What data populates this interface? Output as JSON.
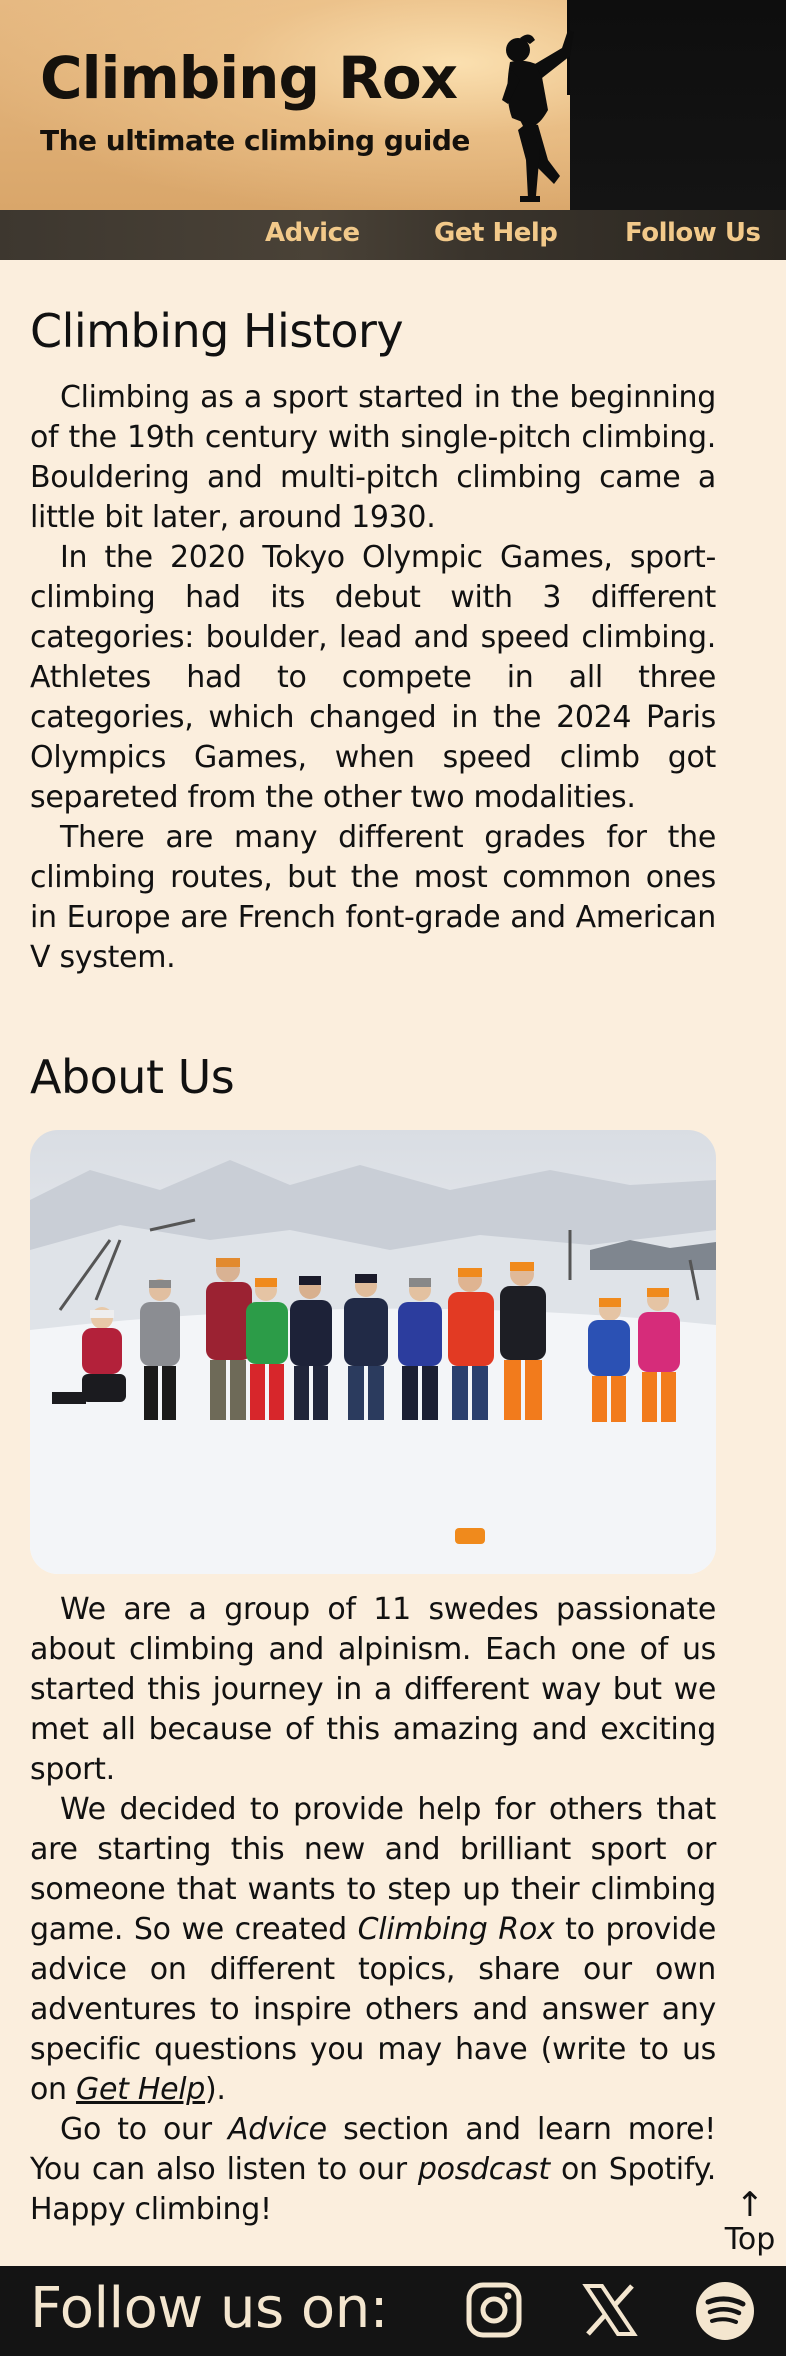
{
  "header": {
    "title": "Climbing Rox",
    "subtitle": "The ultimate climbing guide"
  },
  "nav": {
    "items": [
      {
        "label": "Advice"
      },
      {
        "label": "Get Help"
      },
      {
        "label": "Follow Us"
      }
    ]
  },
  "history": {
    "title": "Climbing History",
    "paragraphs": [
      "Climbing as a sport started in the beginning of the 19th century with single-pitch climbing. Bouldering and multi-pitch climbing came a little bit later, around 1930.",
      "In the 2020 Tokyo Olympic Games, sport-climbing had its debut with 3 different categories: boulder, lead and speed climbing. Athletes had to compete in all three categories, which changed in the 2024 Paris Olympics Games, when speed climb got separeted from the other two modalities.",
      "There are many different grades for the climbing routes, but the most common ones in Europe are French font-grade and American V system."
    ]
  },
  "about": {
    "title": "About Us",
    "p1": "We are a group of 11 swedes passionate about climbing and alpinism. Each one of us started this journey in a different way but we met all because of this amazing and exciting sport.",
    "p2_before": "We decided to provide help for others that are starting this new and brilliant sport or someone that wants to step up their climbing game. So we created ",
    "p2_em": "Climbing Rox",
    "p2_middle": " to provide advice on different topics, share our own adventures to inspire others and answer any specific questions you may have (write to us on ",
    "p2_link": "Get Help",
    "p2_after": ").",
    "p3_a": "Go to our ",
    "p3_em1": "Advice",
    "p3_b": " section and learn more! You can also listen to our ",
    "p3_em2": "posdcast",
    "p3_c": " on Spotify. Happy climbing!"
  },
  "top_link": {
    "arrow": "↑",
    "label": "Top"
  },
  "footer": {
    "label": "Follow us on:",
    "socials": [
      "instagram-icon",
      "x-icon",
      "spotify-icon"
    ]
  },
  "colors": {
    "page_bg": "#fbeedd",
    "nav_text": "#f2c98a",
    "footer_bg": "#141414",
    "footer_text": "#f4e6cf"
  }
}
